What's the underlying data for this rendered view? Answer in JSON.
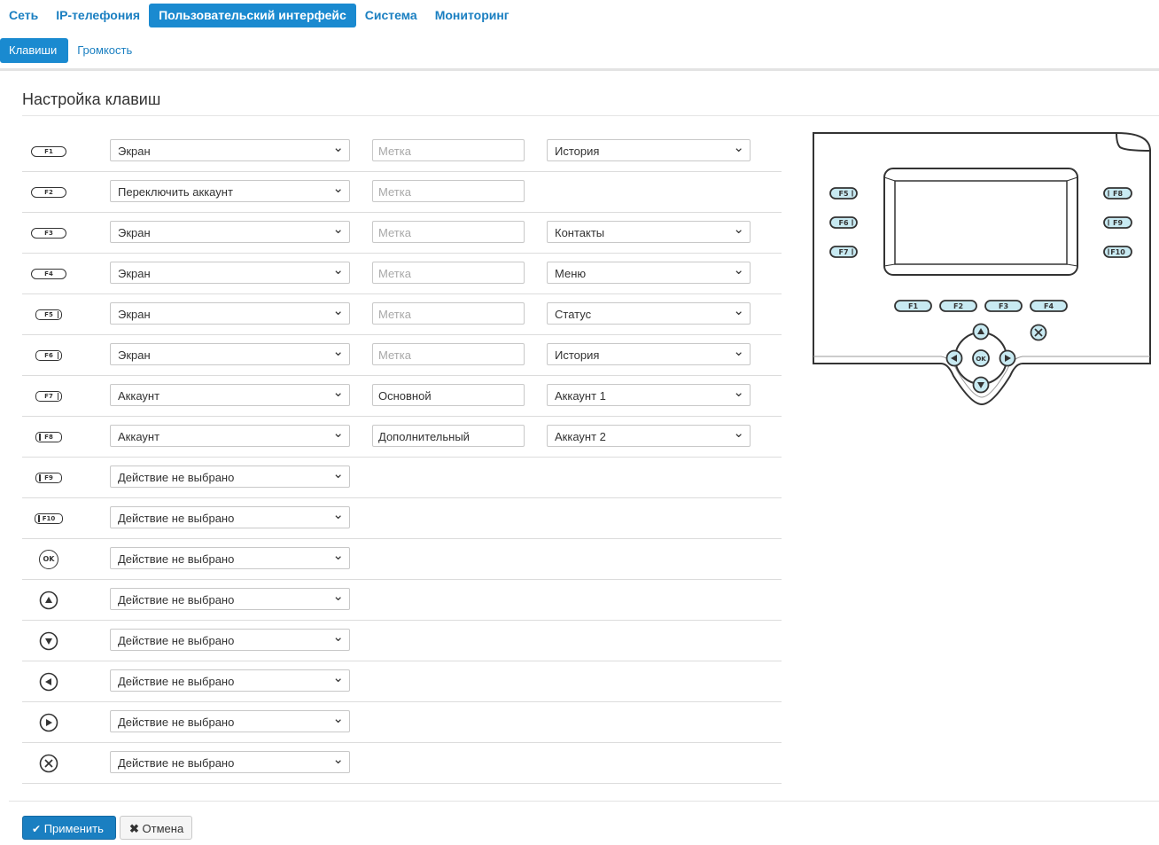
{
  "topnav": [
    "Сеть",
    "IP-телефония",
    "Пользовательский интерфейс",
    "Система",
    "Мониторинг"
  ],
  "subnav": [
    "Клавиши",
    "Громкость"
  ],
  "page_title": "Настройка клавиш",
  "rows": [
    {
      "key": "F1",
      "action": "Экран",
      "label": "",
      "placeholder": "Метка",
      "target": "История"
    },
    {
      "key": "F2",
      "action": "Переключить аккаунт",
      "label": "",
      "placeholder": "Метка",
      "target": null
    },
    {
      "key": "F3",
      "action": "Экран",
      "label": "",
      "placeholder": "Метка",
      "target": "Контакты"
    },
    {
      "key": "F4",
      "action": "Экран",
      "label": "",
      "placeholder": "Метка",
      "target": "Меню"
    },
    {
      "key": "F5",
      "action": "Экран",
      "label": "",
      "placeholder": "Метка",
      "target": "Статус"
    },
    {
      "key": "F6",
      "action": "Экран",
      "label": "",
      "placeholder": "Метка",
      "target": "История"
    },
    {
      "key": "F7",
      "action": "Аккаунт",
      "label": "Основной",
      "placeholder": "Метка",
      "target": "Аккаунт 1"
    },
    {
      "key": "F8",
      "action": "Аккаунт",
      "label": "Дополнительный",
      "placeholder": "Метка",
      "target": "Аккаунт 2"
    },
    {
      "key": "F9",
      "action": "Действие не выбрано",
      "label": null,
      "placeholder": null,
      "target": null
    },
    {
      "key": "F10",
      "action": "Действие не выбрано",
      "label": null,
      "placeholder": null,
      "target": null
    },
    {
      "key": "OK",
      "action": "Действие не выбрано",
      "label": null,
      "placeholder": null,
      "target": null
    },
    {
      "key": "up-icon",
      "action": "Действие не выбрано",
      "label": null,
      "placeholder": null,
      "target": null
    },
    {
      "key": "down-icon",
      "action": "Действие не выбрано",
      "label": null,
      "placeholder": null,
      "target": null
    },
    {
      "key": "left-icon",
      "action": "Действие не выбрано",
      "label": null,
      "placeholder": null,
      "target": null
    },
    {
      "key": "right-icon",
      "action": "Действие не выбрано",
      "label": null,
      "placeholder": null,
      "target": null
    },
    {
      "key": "cancel-icon",
      "action": "Действие не выбрано",
      "label": null,
      "placeholder": null,
      "target": null
    }
  ],
  "phone": {
    "left_keys": [
      "F5",
      "F6",
      "F7"
    ],
    "right_keys": [
      "F8",
      "F9",
      "F10"
    ],
    "bottom_keys": [
      "F1",
      "F2",
      "F3",
      "F4"
    ],
    "ok_label": "OK"
  },
  "buttons": {
    "apply": "Применить",
    "cancel": "Отмена"
  },
  "colors": {
    "accent": "#1a8ad0",
    "key_fill": "#c8eaf2"
  }
}
